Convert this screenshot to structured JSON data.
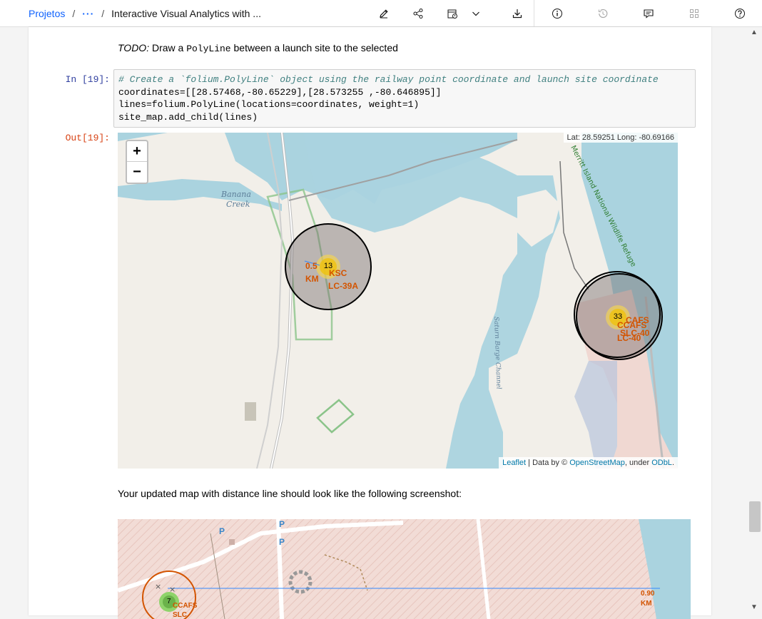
{
  "breadcrumb": {
    "root": "Projetos",
    "separator": "/",
    "ellipsis": "···",
    "current": "Interactive Visual Analytics with ..."
  },
  "toolbar_icons": [
    "edit-icon",
    "share-icon",
    "schedule-icon",
    "chevron-down-icon",
    "download-icon",
    "info-icon",
    "history-icon",
    "comment-icon",
    "environment-icon",
    "help-icon"
  ],
  "cells": {
    "todo": {
      "prefix": "TODO:",
      "text_before": " Draw a ",
      "code": "PolyLine",
      "text_after": " between a launch site to the selected"
    },
    "input_prompt": "In [19]:",
    "code_lines": [
      "# Create a `folium.PolyLine` object using the railway point coordinate and launch site coordinate",
      "coordinates=[[28.57468,-80.65229],[28.573255 ,-80.646895]]",
      "lines=folium.PolyLine(locations=coordinates, weight=1)",
      "site_map.add_child(lines)"
    ],
    "output_prompt": "Out[19]:",
    "after_text": "Your updated map with distance line should look like the following screenshot:"
  },
  "map": {
    "zoom_in": "+",
    "zoom_out": "−",
    "mouse_position": "Lat: 28.59251 Long: -80.69166",
    "attribution": {
      "leaflet": "Leaflet",
      "data_by": " | Data by © ",
      "osm": "OpenStreetMap",
      "under": ", under ",
      "odbl": "ODbL",
      "end": "."
    },
    "place_labels": [
      "Banana",
      "Creek",
      "Merritt Island National Wildlife Refuge",
      "Saturn Barge Channel"
    ],
    "clusters": [
      {
        "count": "13",
        "labels": [
          "0.5",
          "KM",
          "KSC",
          "LC-39A"
        ]
      },
      {
        "count": "33",
        "labels": [
          "CCAFS",
          "SLC-40",
          "LC-40",
          "CAFS"
        ]
      }
    ]
  },
  "screenshot": {
    "distance_label_1": "0.90",
    "distance_label_2": "KM",
    "parking": [
      "P",
      "P",
      "P"
    ],
    "cluster_count": "7",
    "cluster_label": "CCAFS",
    "cluster_label_2": "SLC"
  },
  "colors": {
    "accent": "#0f62fe",
    "prompt_in": "#303f9f",
    "prompt_out": "#d84315",
    "water": "#aad3df",
    "land": "#f2efe9",
    "marker_label": "#d35400"
  }
}
